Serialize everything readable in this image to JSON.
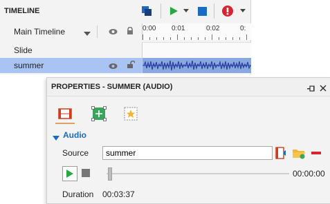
{
  "timeline": {
    "title": "TIMELINE",
    "main_timeline_label": "Main Timeline",
    "ruler_ticks": [
      "0:00",
      "0:01",
      "0:02",
      "0:"
    ],
    "rows": [
      {
        "label": "Slide"
      },
      {
        "label": "summer"
      }
    ]
  },
  "properties": {
    "title": "PROPERTIES - SUMMER (AUDIO)",
    "section_label": "Audio",
    "source_label": "Source",
    "source_value": "summer",
    "time_display": "00:00:00",
    "duration_label": "Duration",
    "duration_value": "00:03:37"
  },
  "colors": {
    "selected_row": "#a9c4f2",
    "accent_blue": "#1a6bc4",
    "play_green": "#28a745",
    "record_red": "#d9242f"
  }
}
